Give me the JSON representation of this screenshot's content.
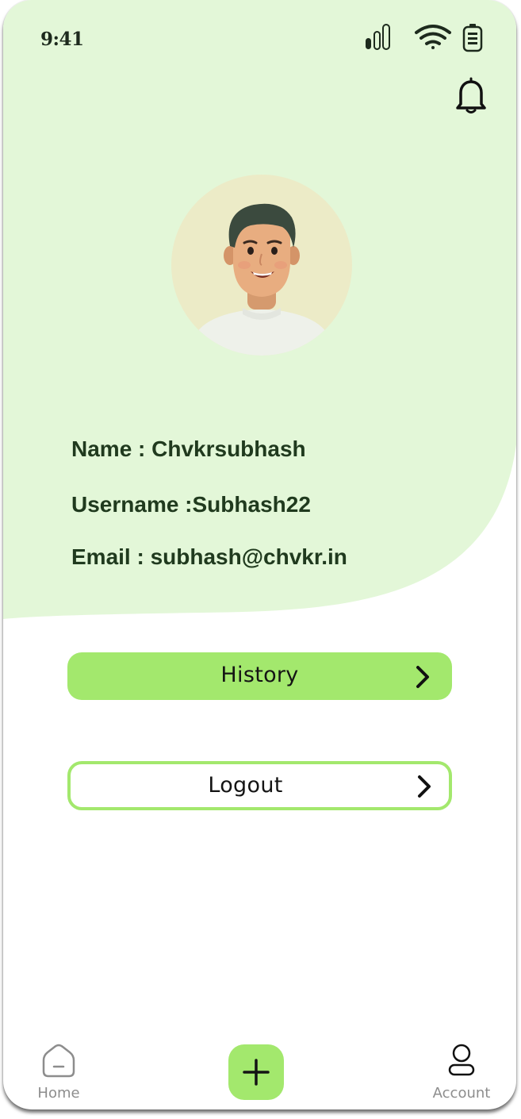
{
  "status_bar": {
    "time": "9:41",
    "icons": [
      "cellular-signal-icon",
      "wifi-icon",
      "battery-icon"
    ]
  },
  "header": {
    "notification_icon": "bell-icon"
  },
  "profile": {
    "avatar": "profile-avatar",
    "name_line": "Name : Chvkrsubhash",
    "username_line": "Username :Subhash22",
    "email_line": "Email : subhash@chvkr.in"
  },
  "actions": {
    "history_label": "History",
    "logout_label": "Logout",
    "chevron_icon": "chevron-right-icon"
  },
  "bottom_nav": {
    "home_label": "Home",
    "home_icon": "home-icon",
    "add_icon": "plus-icon",
    "account_label": "Account",
    "account_icon": "user-icon"
  },
  "colors": {
    "header_background": "#e3f7d8",
    "accent_green": "#a3e86d",
    "text_dark_green": "#203a1e",
    "nav_label_gray": "#8d8d8d"
  }
}
